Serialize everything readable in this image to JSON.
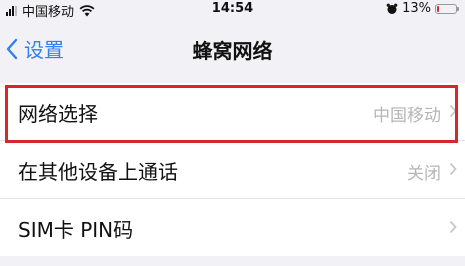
{
  "status_bar": {
    "carrier": "中国移动",
    "time": "14:54",
    "battery": "13%",
    "battery_level": 0.13,
    "battery_color": "#e0262c"
  },
  "nav": {
    "back_label": "设置",
    "title": "蜂窝网络"
  },
  "rows": [
    {
      "label": "网络选择",
      "value": "中国移动"
    },
    {
      "label": "在其他设备上通话",
      "value": "关闭"
    },
    {
      "label": "SIM卡 PIN码",
      "value": ""
    }
  ],
  "colors": {
    "accent": "#2f7ff5",
    "highlight": "#d8262a",
    "background": "#f2f2f6"
  },
  "icons": [
    "signal-icon",
    "wifi-icon",
    "alarm-icon",
    "battery-icon",
    "back-chevron-icon",
    "chevron-right-icon"
  ]
}
